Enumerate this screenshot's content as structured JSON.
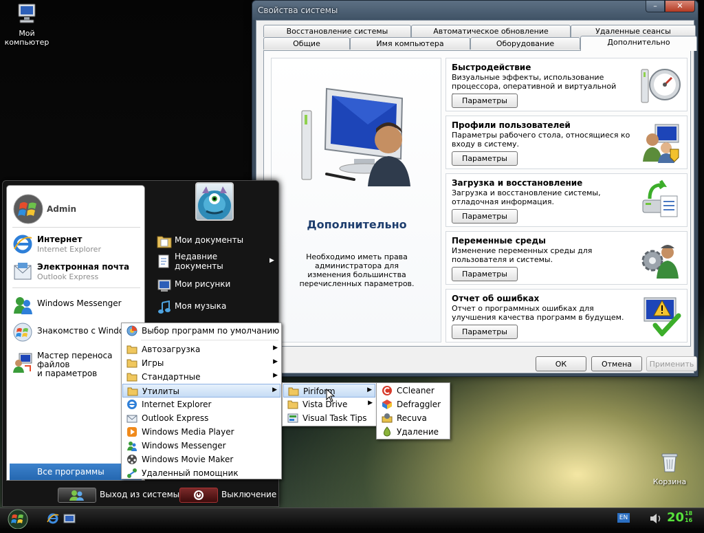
{
  "desktop": {
    "icons": [
      {
        "label": "Мой\nкомпьютер"
      },
      {
        "label": "Корзина"
      }
    ]
  },
  "window": {
    "title": "Свойства системы",
    "min_glyph": "–",
    "close_glyph": "✕",
    "tabs_top": [
      "Восстановление системы",
      "Автоматическое обновление",
      "Удаленные сеансы"
    ],
    "tabs_bottom": [
      "Общие",
      "Имя компьютера",
      "Оборудование",
      "Дополнительно"
    ],
    "left_title": "Дополнительно",
    "left_desc": "Необходимо иметь права администратора для изменения большинства перечисленных параметров.",
    "sections": [
      {
        "title": "Быстродействие",
        "desc": "Визуальные эффекты, использование процессора, оперативной и виртуальной памяти.",
        "button": "Параметры",
        "icon": "performance-gauge-icon"
      },
      {
        "title": "Профили пользователей",
        "desc": "Параметры рабочего стола, относящиеся ко входу в систему.",
        "button": "Параметры",
        "icon": "user-profiles-icon"
      },
      {
        "title": "Загрузка и восстановление",
        "desc": "Загрузка и восстановление системы, отладочная информация.",
        "button": "Параметры",
        "icon": "startup-recovery-icon"
      },
      {
        "title": "Переменные среды",
        "desc": "Изменение переменных среды для пользователя и системы.",
        "button": "Параметры",
        "icon": "environment-variables-icon"
      },
      {
        "title": "Отчет об ошибках",
        "desc": "Отчет о программных ошибках для улучшения качества программ в будущем.",
        "button": "Параметры",
        "icon": "error-reporting-icon"
      }
    ],
    "ok": "ОК",
    "cancel": "Отмена",
    "apply": "Применить"
  },
  "start_menu": {
    "user": "Admin",
    "pinned": [
      {
        "title": "Интернет",
        "sub": "Internet Explorer"
      },
      {
        "title": "Электронная почта",
        "sub": "Outlook Express"
      }
    ],
    "recent": [
      {
        "title": "Windows Messenger"
      },
      {
        "title": "Знакомство с Windows"
      },
      {
        "title": "Мастер переноса файлов\nи параметров"
      }
    ],
    "all_programs": "Все программы",
    "all_programs_arrow": "▶",
    "right_items": [
      {
        "label": "Мои документы"
      },
      {
        "label": "Недавние\nдокументы",
        "arrow": "▶"
      },
      {
        "label": "Мои рисунки"
      },
      {
        "label": "Моя музыка"
      }
    ],
    "logoff": "Выход из системы",
    "shutdown": "Выключение"
  },
  "programs_menu": {
    "items": [
      {
        "label": "Выбор программ по умолчанию",
        "icon": "default-programs-icon"
      },
      {
        "label": "Автозагрузка",
        "icon": "folder-icon",
        "arrow": "▶"
      },
      {
        "label": "Игры",
        "icon": "folder-icon",
        "arrow": "▶"
      },
      {
        "label": "Стандартные",
        "icon": "folder-icon",
        "arrow": "▶"
      },
      {
        "label": "Утилиты",
        "icon": "folder-icon",
        "arrow": "▶",
        "highlighted": true
      },
      {
        "label": "Internet Explorer",
        "icon": "internet-explorer-icon"
      },
      {
        "label": "Outlook Express",
        "icon": "outlook-express-icon"
      },
      {
        "label": "Windows Media Player",
        "icon": "media-player-icon"
      },
      {
        "label": "Windows Messenger",
        "icon": "messenger-icon"
      },
      {
        "label": "Windows Movie Maker",
        "icon": "movie-maker-icon"
      },
      {
        "label": "Удаленный помощник",
        "icon": "remote-assistance-icon"
      }
    ]
  },
  "utilities_menu": {
    "items": [
      {
        "label": "Piriform",
        "arrow": "▶",
        "highlighted": true
      },
      {
        "label": "Vista Drive",
        "arrow": "▶"
      },
      {
        "label": "Visual Task Tips"
      }
    ]
  },
  "piriform_menu": {
    "items": [
      {
        "label": "CCleaner"
      },
      {
        "label": "Defraggler"
      },
      {
        "label": "Recuva"
      },
      {
        "label": "Удаление"
      }
    ]
  },
  "taskbar": {
    "language": "EN",
    "clock_hours": "20",
    "clock_minutes_top": "18",
    "clock_minutes_bottom": "16"
  },
  "colors": {
    "accent": "#2567b0",
    "clock": "#57e23b",
    "shutdown": "#7c2a2a"
  }
}
